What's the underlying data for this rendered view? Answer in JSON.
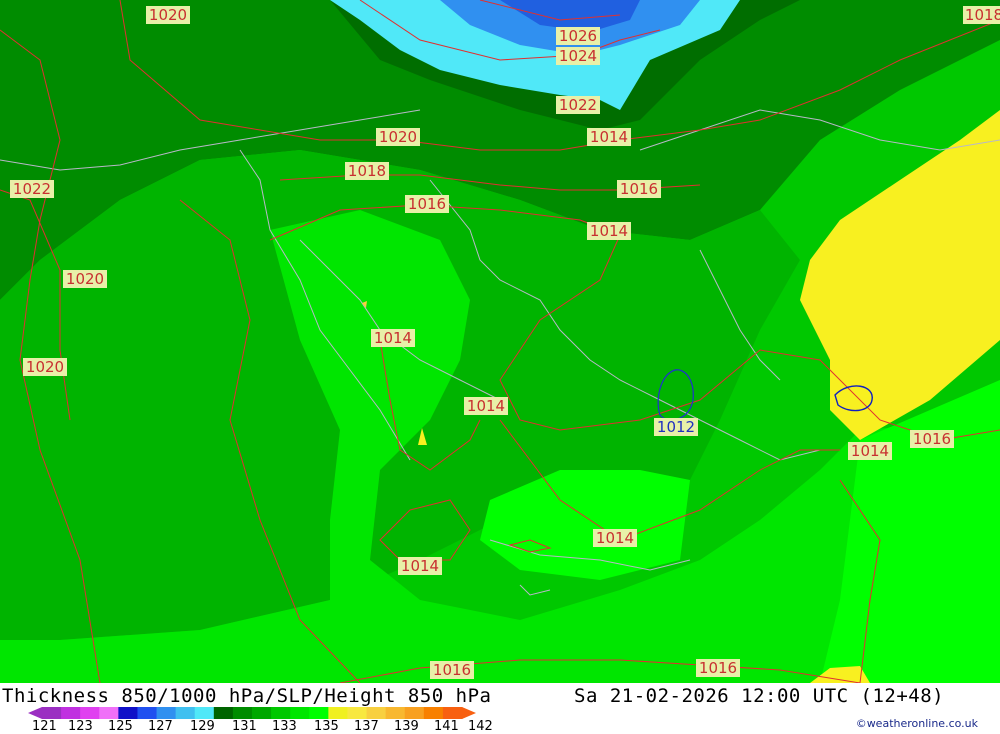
{
  "title": "Thickness 850/1000 hPa/SLP/Height 850 hPa",
  "datetime": "Sa 21-02-2026 12:00 UTC (12+48)",
  "credit": "©weatheronline.co.uk",
  "legend": {
    "ticks": [
      "121",
      "123",
      "125",
      "127",
      "129",
      "131",
      "133",
      "135",
      "137",
      "139",
      "141",
      "142"
    ],
    "colors": [
      "#9b2fc2",
      "#c030e0",
      "#e040f0",
      "#f070f8",
      "#1010c8",
      "#2050f0",
      "#3090f0",
      "#40c0f0",
      "#50e8f8",
      "#006400",
      "#008c00",
      "#00a800",
      "#00c800",
      "#00e600",
      "#00ff00",
      "#f0f020",
      "#f8e840",
      "#f8d040",
      "#f8b830",
      "#f8a020",
      "#f88000",
      "#f86010"
    ]
  },
  "isobars": {
    "labels": [
      "1020",
      "1026",
      "1024",
      "1022",
      "1018",
      "1020",
      "1018",
      "1016",
      "1016",
      "1014",
      "1022",
      "1020",
      "1014",
      "1020",
      "1014",
      "1012",
      "1014",
      "1016",
      "1014",
      "1014",
      "1016",
      "1016",
      "1014"
    ]
  }
}
